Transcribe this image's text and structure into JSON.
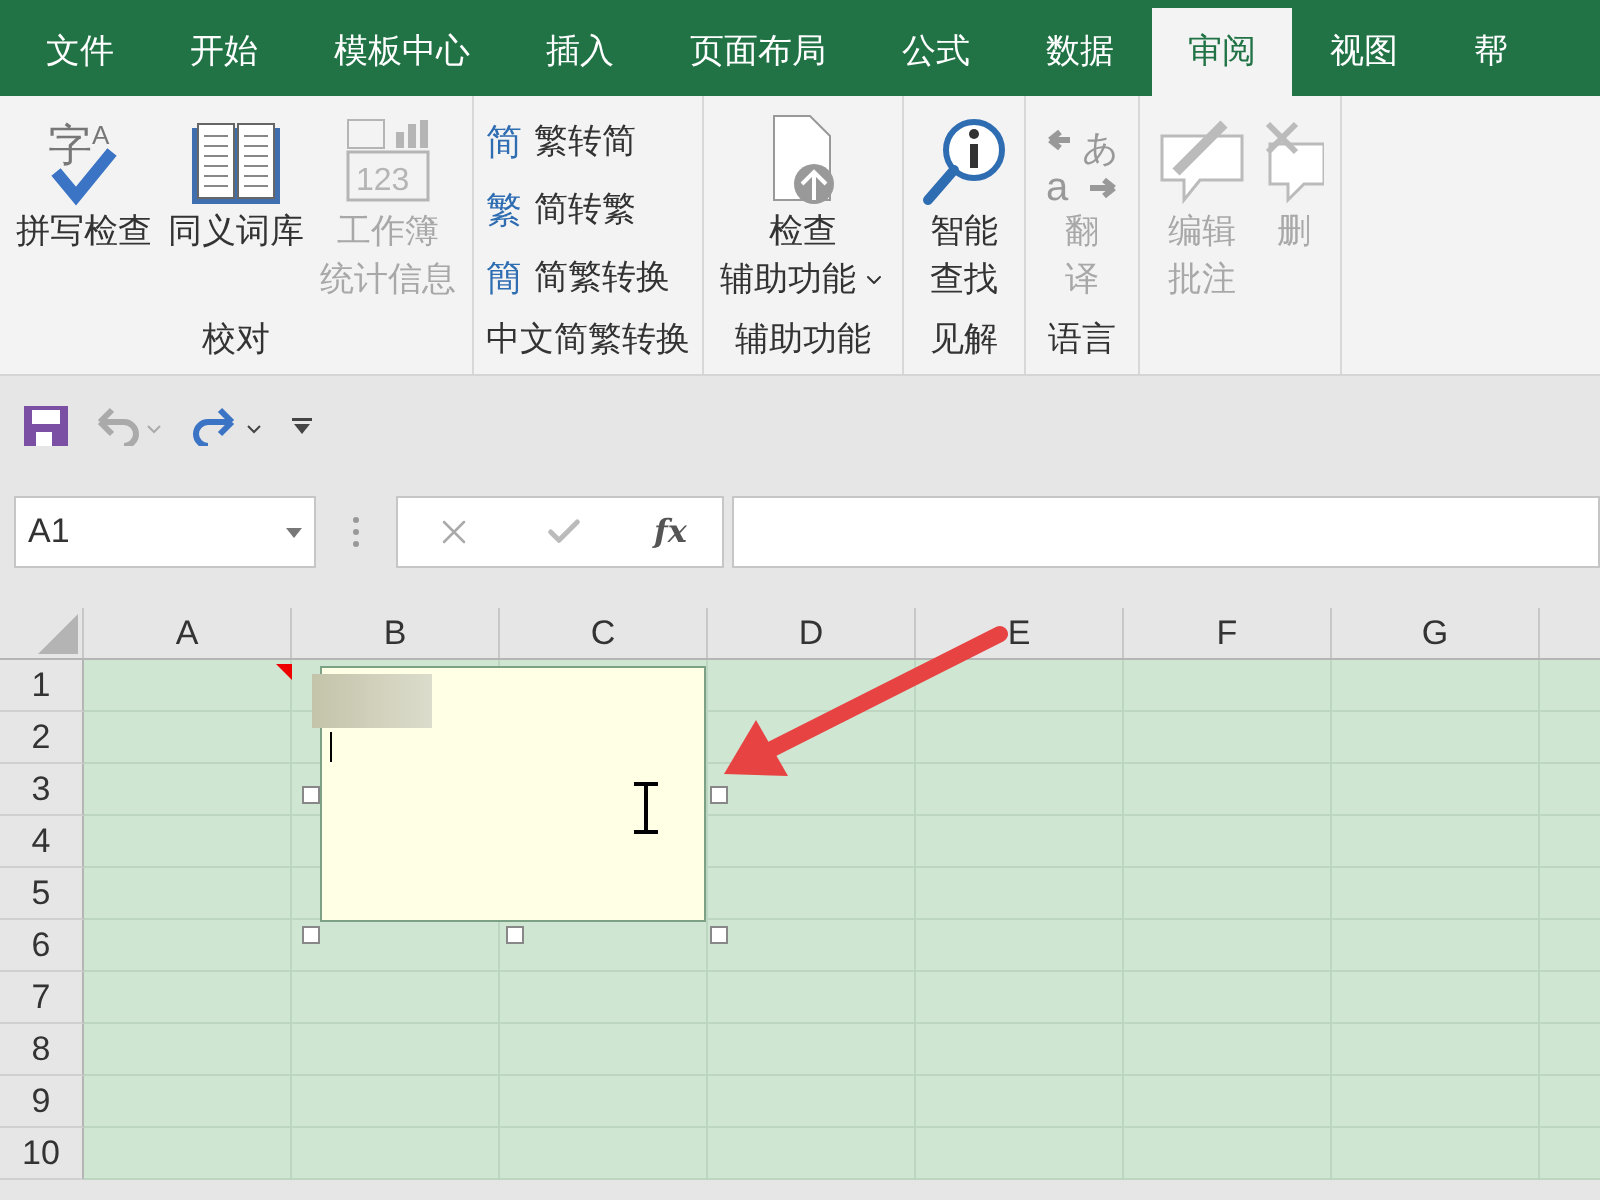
{
  "tabs": [
    {
      "label": "文件",
      "selected": false
    },
    {
      "label": "开始",
      "selected": false
    },
    {
      "label": "模板中心",
      "selected": false
    },
    {
      "label": "插入",
      "selected": false
    },
    {
      "label": "页面布局",
      "selected": false
    },
    {
      "label": "公式",
      "selected": false
    },
    {
      "label": "数据",
      "selected": false
    },
    {
      "label": "审阅",
      "selected": true
    },
    {
      "label": "视图",
      "selected": false
    },
    {
      "label": "帮",
      "selected": false
    }
  ],
  "ribbon": {
    "groups": [
      {
        "label": "校对",
        "buttons": [
          {
            "kind": "large",
            "lines": [
              "拼写检查"
            ],
            "icon_texts": [
              "字",
              "A"
            ],
            "disabled": false
          },
          {
            "kind": "large",
            "lines": [
              "同义词库"
            ],
            "disabled": false
          },
          {
            "kind": "large",
            "lines": [
              "工作簿",
              "统计信息"
            ],
            "icon_texts": [
              "123"
            ],
            "disabled": true
          }
        ]
      },
      {
        "label": "中文简繁转换",
        "buttons": [
          {
            "kind": "small",
            "glyph": "简",
            "label": "繁转简",
            "disabled": false
          },
          {
            "kind": "small",
            "glyph": "繁",
            "label": "简转繁",
            "disabled": false
          },
          {
            "kind": "small",
            "glyph": "簡",
            "label": "简繁转换",
            "disabled": false
          }
        ]
      },
      {
        "label": "辅助功能",
        "buttons": [
          {
            "kind": "large",
            "lines": [
              "检查",
              "辅助功能"
            ],
            "dropdown": true,
            "disabled": false
          }
        ]
      },
      {
        "label": "见解",
        "buttons": [
          {
            "kind": "large",
            "lines": [
              "智能",
              "查找"
            ],
            "disabled": false
          }
        ]
      },
      {
        "label": "语言",
        "buttons": [
          {
            "kind": "large",
            "lines": [
              "翻",
              "译"
            ],
            "icon_texts": [
              "あ",
              "a"
            ],
            "disabled": true
          }
        ]
      },
      {
        "buttons": [
          {
            "kind": "large",
            "lines": [
              "编辑",
              "批注"
            ],
            "disabled": true
          },
          {
            "kind": "large",
            "lines": [
              "删"
            ],
            "disabled": true
          }
        ]
      }
    ]
  },
  "formula_bar": {
    "name_box": "A1",
    "fx": "fx"
  },
  "sheet": {
    "columns": [
      "A",
      "B",
      "C",
      "D",
      "E",
      "F",
      "G"
    ],
    "rows": [
      "1",
      "2",
      "3",
      "4",
      "5",
      "6",
      "7",
      "8",
      "9",
      "10"
    ]
  }
}
